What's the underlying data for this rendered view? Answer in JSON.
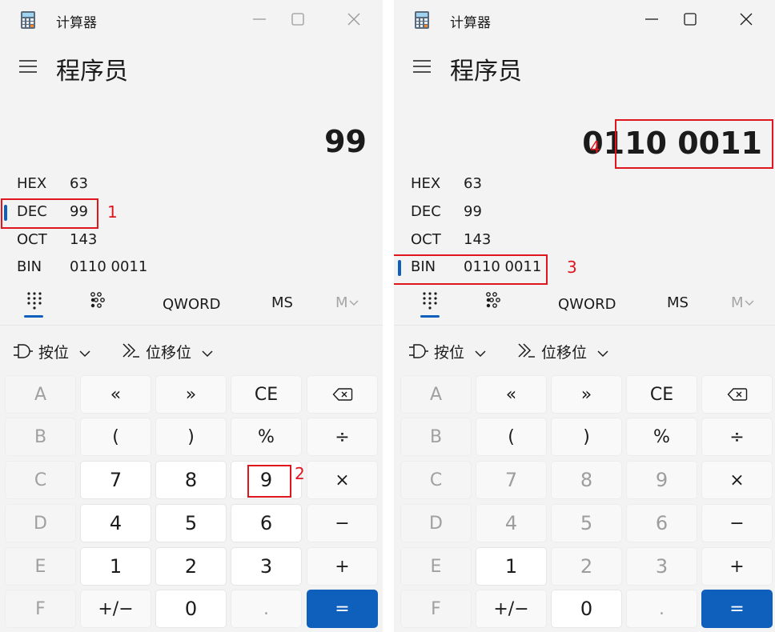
{
  "left": {
    "app_title": "计算器",
    "mode": "程序员",
    "display": "99",
    "radix": [
      {
        "label": "HEX",
        "value": "63"
      },
      {
        "label": "DEC",
        "value": "99"
      },
      {
        "label": "OCT",
        "value": "143"
      },
      {
        "label": "BIN",
        "value": "0110 0011"
      }
    ],
    "tabs": {
      "word_size": "QWORD",
      "ms": "MS",
      "mr": "M"
    },
    "dropdowns": {
      "bitwise": "按位",
      "bitshift": "位移位"
    },
    "keys": [
      [
        "A",
        "«",
        "»",
        "CE",
        "⌫"
      ],
      [
        "B",
        "(",
        ")",
        "%",
        "÷"
      ],
      [
        "C",
        "7",
        "8",
        "9",
        "×"
      ],
      [
        "D",
        "4",
        "5",
        "6",
        "−"
      ],
      [
        "E",
        "1",
        "2",
        "3",
        "+"
      ],
      [
        "F",
        "+/−",
        "0",
        ".",
        "="
      ]
    ],
    "annotations": {
      "dec": "1",
      "key9": "2"
    }
  },
  "right": {
    "app_title": "计算器",
    "mode": "程序员",
    "display": "0110 0011",
    "radix": [
      {
        "label": "HEX",
        "value": "63"
      },
      {
        "label": "DEC",
        "value": "99"
      },
      {
        "label": "OCT",
        "value": "143"
      },
      {
        "label": "BIN",
        "value": "0110 0011"
      }
    ],
    "tabs": {
      "word_size": "QWORD",
      "ms": "MS",
      "mr": "M"
    },
    "dropdowns": {
      "bitwise": "按位",
      "bitshift": "位移位"
    },
    "keys": [
      [
        "A",
        "«",
        "»",
        "CE",
        "⌫"
      ],
      [
        "B",
        "(",
        ")",
        "%",
        "÷"
      ],
      [
        "C",
        "7",
        "8",
        "9",
        "×"
      ],
      [
        "D",
        "4",
        "5",
        "6",
        "−"
      ],
      [
        "E",
        "1",
        "2",
        "3",
        "+"
      ],
      [
        "F",
        "+/−",
        "0",
        ".",
        "="
      ]
    ],
    "annotations": {
      "bin": "3",
      "display": "4"
    }
  },
  "colors": {
    "accent": "#0f5fbd",
    "annotation": "#e0161e"
  }
}
